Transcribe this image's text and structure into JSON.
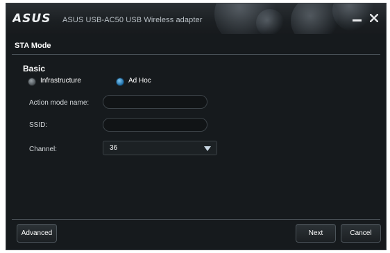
{
  "window": {
    "brand": "ASUS",
    "title": "ASUS USB-AC50 USB Wireless adapter"
  },
  "section": {
    "title": "STA Mode"
  },
  "basic": {
    "title": "Basic",
    "modes": [
      {
        "label": "Infrastructure",
        "selected": false
      },
      {
        "label": "Ad Hoc",
        "selected": true
      }
    ],
    "fields": {
      "action_mode_name": {
        "label": "Action mode name:",
        "value": ""
      },
      "ssid": {
        "label": "SSID:",
        "value": ""
      },
      "channel": {
        "label": "Channel:",
        "value": "36"
      }
    }
  },
  "footer": {
    "advanced_label": "Advanced",
    "next_label": "Next",
    "cancel_label": "Cancel"
  },
  "colors": {
    "background": "#161a1d",
    "accent_radio": "#1f6fa8",
    "text": "#ffffff"
  },
  "icons": [
    "asus-logo",
    "minimize-icon",
    "close-icon",
    "dropdown-arrow-icon"
  ]
}
